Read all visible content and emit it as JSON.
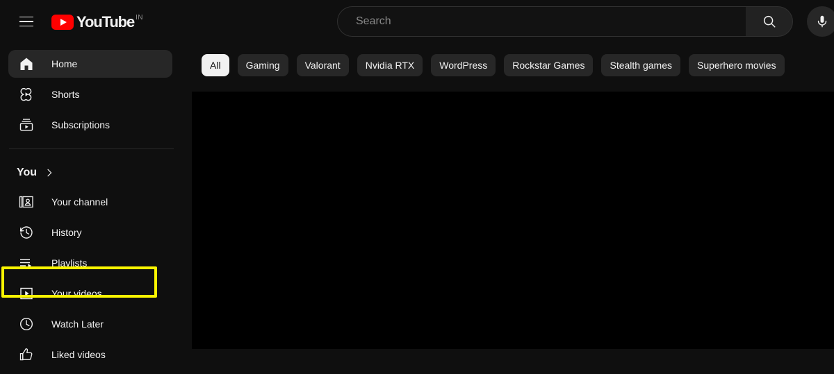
{
  "topbar": {
    "menu_icon": "hamburger-menu-icon",
    "logo_text": "YouTube",
    "logo_superscript": "IN",
    "logo_play_icon": "youtube-play-icon",
    "search": {
      "value": "",
      "placeholder": "Search",
      "button_icon": "search-icon",
      "mic_icon": "microphone-icon"
    }
  },
  "sidebar": {
    "primary": [
      {
        "label": "Home",
        "icon": "home-icon",
        "active": true
      },
      {
        "label": "Shorts",
        "icon": "shorts-icon",
        "active": false
      },
      {
        "label": "Subscriptions",
        "icon": "subscriptions-icon",
        "active": false
      }
    ],
    "you_section": {
      "label": "You",
      "chevron_icon": "chevron-right-icon"
    },
    "you_items": [
      {
        "label": "Your channel",
        "icon": "your-channel-icon"
      },
      {
        "label": "History",
        "icon": "history-icon",
        "highlighted": true
      },
      {
        "label": "Playlists",
        "icon": "playlists-icon"
      },
      {
        "label": "Your videos",
        "icon": "your-videos-icon"
      },
      {
        "label": "Watch Later",
        "icon": "watch-later-icon"
      },
      {
        "label": "Liked videos",
        "icon": "liked-videos-icon"
      }
    ]
  },
  "main": {
    "chips": [
      {
        "label": "All",
        "active": true
      },
      {
        "label": "Gaming",
        "active": false
      },
      {
        "label": "Valorant",
        "active": false
      },
      {
        "label": "Nvidia RTX",
        "active": false
      },
      {
        "label": "WordPress",
        "active": false
      },
      {
        "label": "Rockstar Games",
        "active": false
      },
      {
        "label": "Stealth games",
        "active": false
      },
      {
        "label": "Superhero movies",
        "active": false
      }
    ]
  },
  "colors": {
    "background": "#0f0f0f",
    "highlight": "#fbf500",
    "brand_red": "#ff0000",
    "chip_active": "#f1f1f1",
    "content_panel": "#000000"
  }
}
